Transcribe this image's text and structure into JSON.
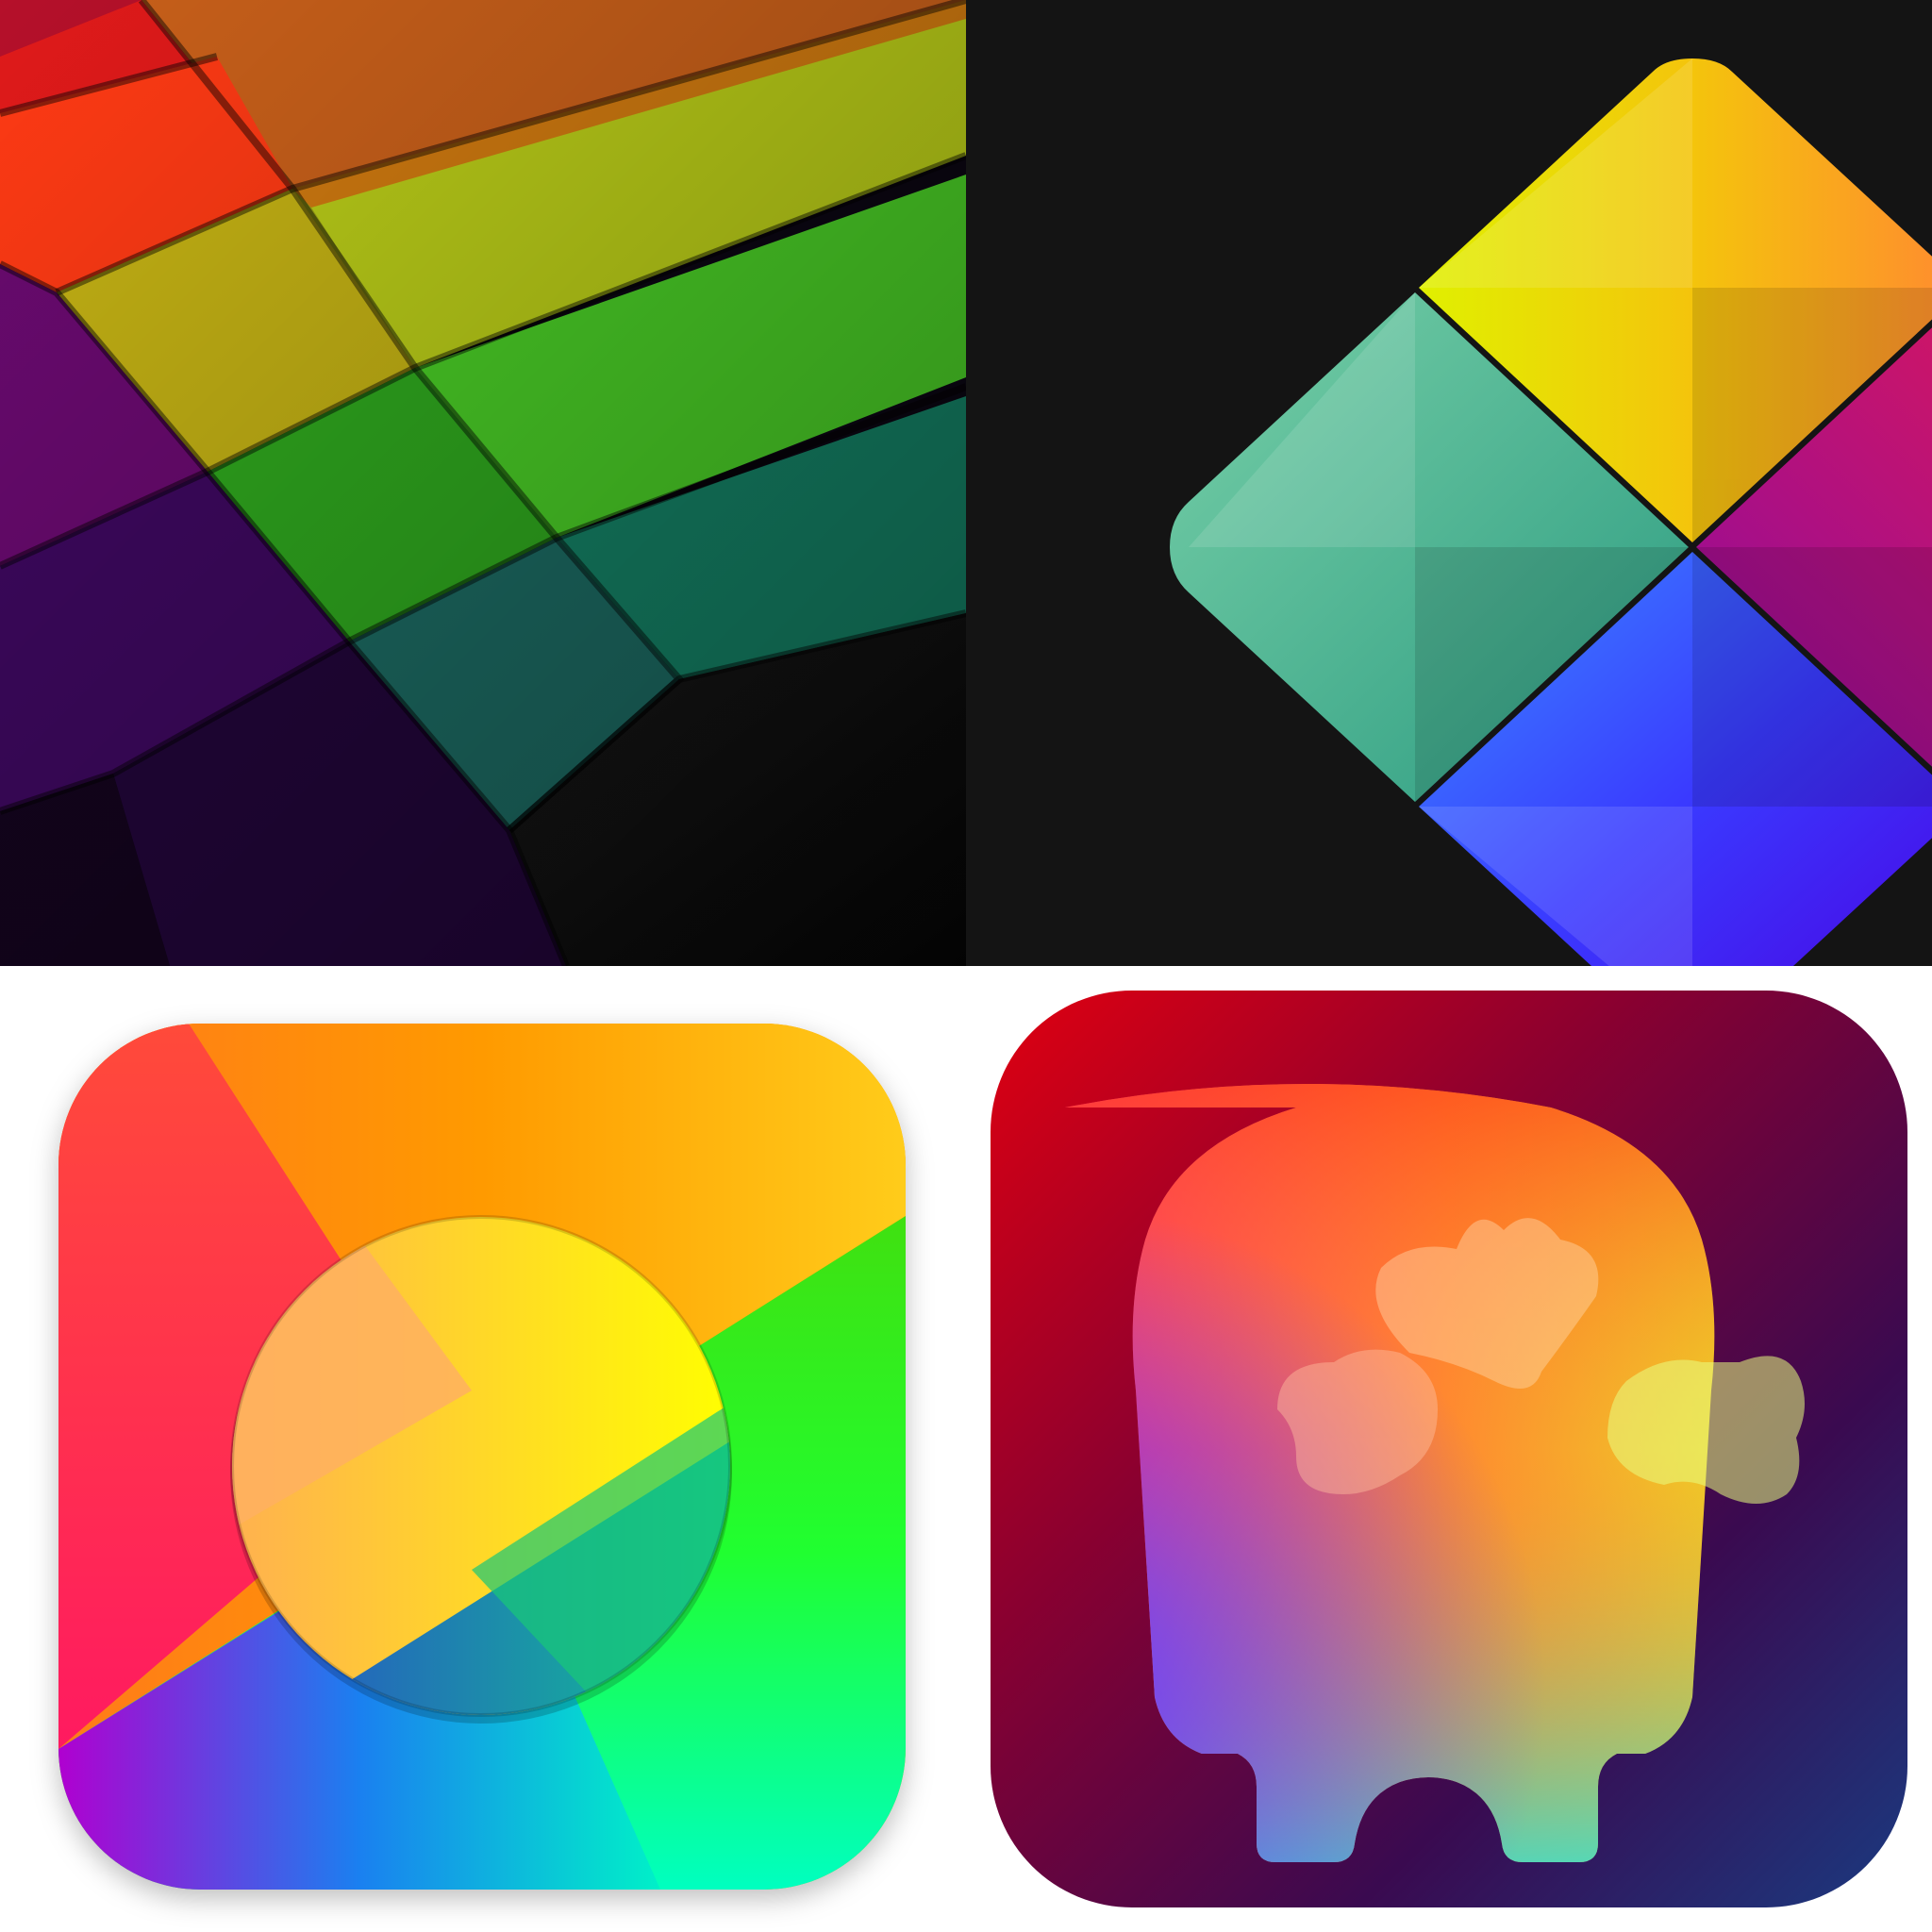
{
  "panels": [
    {
      "id": "wallpaper",
      "icon": "rainbow-tiles-wallpaper"
    },
    {
      "id": "diamond",
      "icon": "four-part-diamond-icon",
      "background": "#141414"
    },
    {
      "id": "color-wheel",
      "icon": "color-wheel-app-icon"
    },
    {
      "id": "skull",
      "icon": "rainbow-skull-app-icon"
    }
  ],
  "palette": {
    "red": "#ff2a2a",
    "orange": "#ff9a00",
    "yellow": "#ffee00",
    "green": "#2ad42a",
    "teal": "#17a088",
    "blue": "#2a4dff",
    "purple": "#5a00c8",
    "magenta": "#d4106a"
  }
}
